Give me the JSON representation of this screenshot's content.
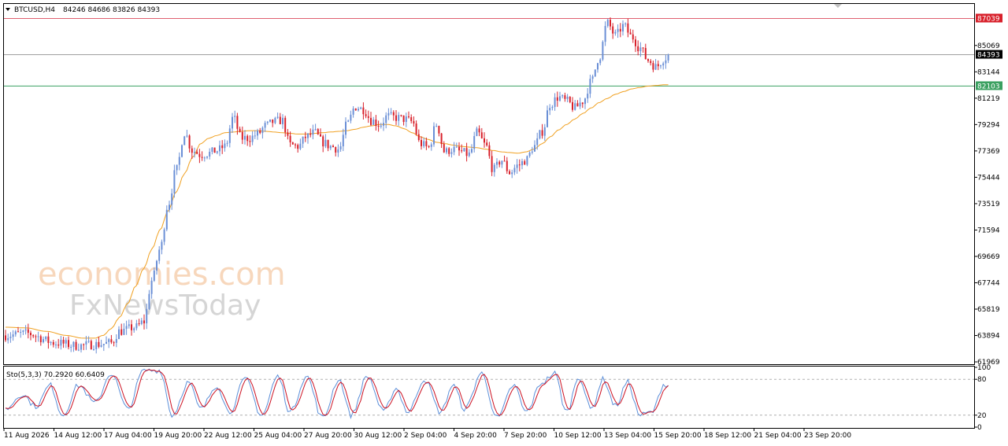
{
  "header": {
    "symbol": "BTCUSD,H4",
    "ohlc": "84246 84686 83826 84393",
    "arrow_icon": "triangle-down-icon"
  },
  "watermark": {
    "line1": "economies.com",
    "line2": "FxNewsToday"
  },
  "colors": {
    "bull": "#6a8fd6",
    "bear": "#d8202a",
    "ma": "#f0a020",
    "stoch_main": "#5b8fd9",
    "stoch_signal": "#cc1122",
    "resistance": "#e06070",
    "support": "#3aa060",
    "price_line": "#a0a0a0"
  },
  "chart_data": {
    "type": "candlestick",
    "price_axis": {
      "ylim": [
        61800,
        88100
      ],
      "ticks": [
        61969,
        63894,
        65819,
        67744,
        69669,
        71594,
        73519,
        75444,
        77369,
        79294,
        81219,
        83144,
        85069
      ]
    },
    "levels": [
      {
        "id": "resistance",
        "value": 87039,
        "label": "87039"
      },
      {
        "id": "current",
        "value": 84393,
        "label": "84393"
      },
      {
        "id": "support",
        "value": 82103,
        "label": "82103"
      }
    ],
    "time_labels": [
      "11 Aug 2026",
      "14 Aug 12:00",
      "17 Aug 04:00",
      "19 Aug 20:00",
      "22 Aug 12:00",
      "25 Aug 04:00",
      "27 Aug 20:00",
      "30 Aug 12:00",
      "2 Sep 04:00",
      "4 Sep 20:00",
      "7 Sep 20:00",
      "10 Sep 12:00",
      "13 Sep 04:00",
      "15 Sep 20:00",
      "18 Sep 12:00",
      "21 Sep 04:00",
      "23 Sep 20:00"
    ],
    "candle_count": 264,
    "close_path": [
      [
        0,
        63900
      ],
      [
        10,
        64050
      ],
      [
        25,
        63350
      ],
      [
        35,
        63150
      ],
      [
        45,
        63250
      ],
      [
        52,
        63350
      ],
      [
        56,
        64200
      ],
      [
        64,
        64500
      ],
      [
        68,
        64900
      ],
      [
        72,
        67900
      ],
      [
        76,
        70200
      ],
      [
        80,
        73500
      ],
      [
        84,
        76000
      ],
      [
        88,
        78700
      ],
      [
        92,
        77400
      ],
      [
        96,
        77100
      ],
      [
        100,
        77200
      ],
      [
        104,
        77400
      ],
      [
        108,
        77700
      ],
      [
        112,
        79800
      ],
      [
        116,
        78300
      ],
      [
        120,
        78300
      ],
      [
        124,
        78600
      ],
      [
        128,
        79200
      ],
      [
        132,
        79500
      ],
      [
        136,
        79600
      ],
      [
        140,
        77800
      ],
      [
        144,
        77700
      ],
      [
        148,
        78400
      ],
      [
        152,
        78700
      ],
      [
        156,
        78000
      ],
      [
        160,
        77700
      ],
      [
        164,
        77500
      ],
      [
        168,
        79300
      ],
      [
        172,
        80600
      ],
      [
        176,
        80400
      ],
      [
        180,
        79600
      ],
      [
        184,
        79300
      ],
      [
        188,
        79900
      ],
      [
        192,
        79800
      ],
      [
        196,
        79700
      ],
      [
        200,
        79500
      ],
      [
        204,
        77900
      ],
      [
        208,
        77600
      ],
      [
        212,
        79300
      ],
      [
        216,
        77300
      ],
      [
        220,
        77500
      ],
      [
        224,
        77300
      ],
      [
        228,
        77100
      ],
      [
        232,
        78700
      ],
      [
        236,
        77800
      ],
      [
        240,
        76000
      ],
      [
        244,
        76700
      ],
      [
        248,
        75800
      ],
      [
        252,
        76300
      ],
      [
        256,
        76700
      ],
      [
        260,
        77700
      ],
      [
        264,
        78800
      ],
      [
        268,
        80800
      ],
      [
        272,
        81300
      ],
      [
        276,
        81000
      ],
      [
        280,
        80500
      ],
      [
        284,
        81000
      ],
      [
        288,
        82400
      ],
      [
        292,
        84200
      ],
      [
        296,
        86700
      ],
      [
        300,
        85800
      ],
      [
        304,
        86500
      ],
      [
        308,
        85700
      ],
      [
        312,
        84900
      ],
      [
        316,
        84000
      ],
      [
        320,
        83500
      ],
      [
        324,
        84100
      ],
      [
        326,
        84393
      ]
    ],
    "ma_path": [
      [
        0,
        64500
      ],
      [
        10,
        64450
      ],
      [
        20,
        64200
      ],
      [
        30,
        63900
      ],
      [
        38,
        63700
      ],
      [
        44,
        63700
      ],
      [
        48,
        63900
      ],
      [
        52,
        64400
      ],
      [
        56,
        65200
      ],
      [
        60,
        66200
      ],
      [
        64,
        67500
      ],
      [
        68,
        68800
      ],
      [
        72,
        70200
      ],
      [
        76,
        71600
      ],
      [
        80,
        73000
      ],
      [
        84,
        74400
      ],
      [
        88,
        75700
      ],
      [
        92,
        76900
      ],
      [
        96,
        77900
      ],
      [
        100,
        78300
      ],
      [
        104,
        78500
      ],
      [
        108,
        78700
      ],
      [
        112,
        78750
      ],
      [
        116,
        78800
      ],
      [
        120,
        78850
      ],
      [
        124,
        78850
      ],
      [
        128,
        78800
      ],
      [
        132,
        78750
      ],
      [
        136,
        78700
      ],
      [
        140,
        78650
      ],
      [
        144,
        78600
      ],
      [
        148,
        78600
      ],
      [
        152,
        78650
      ],
      [
        156,
        78700
      ],
      [
        160,
        78750
      ],
      [
        164,
        78800
      ],
      [
        168,
        78850
      ],
      [
        172,
        78950
      ],
      [
        176,
        79100
      ],
      [
        180,
        79200
      ],
      [
        184,
        79300
      ],
      [
        188,
        79300
      ],
      [
        192,
        79200
      ],
      [
        196,
        79000
      ],
      [
        200,
        78700
      ],
      [
        204,
        78400
      ],
      [
        208,
        78200
      ],
      [
        212,
        78000
      ],
      [
        216,
        77900
      ],
      [
        220,
        77800
      ],
      [
        224,
        77700
      ],
      [
        228,
        77650
      ],
      [
        232,
        77600
      ],
      [
        236,
        77500
      ],
      [
        240,
        77400
      ],
      [
        244,
        77300
      ],
      [
        248,
        77250
      ],
      [
        252,
        77200
      ],
      [
        256,
        77300
      ],
      [
        260,
        77500
      ],
      [
        264,
        77900
      ],
      [
        268,
        78400
      ],
      [
        272,
        78900
      ],
      [
        276,
        79300
      ],
      [
        280,
        79700
      ],
      [
        284,
        80100
      ],
      [
        288,
        80500
      ],
      [
        292,
        80900
      ],
      [
        296,
        81200
      ],
      [
        300,
        81500
      ],
      [
        304,
        81700
      ],
      [
        308,
        81900
      ],
      [
        312,
        82000
      ],
      [
        316,
        82100
      ],
      [
        320,
        82150
      ],
      [
        324,
        82200
      ],
      [
        326,
        82200
      ]
    ],
    "stochastic": {
      "label": "Sto(5,3,3) 70.2920 60.6409",
      "ylim": [
        0,
        100
      ],
      "ticks": [
        0,
        20,
        80,
        100
      ],
      "levels": [
        20,
        80
      ],
      "cycles": [
        [
          0,
          30
        ],
        [
          8,
          55
        ],
        [
          15,
          35
        ],
        [
          22,
          70
        ],
        [
          28,
          20
        ],
        [
          36,
          70
        ],
        [
          44,
          40
        ],
        [
          52,
          90
        ],
        [
          60,
          30
        ],
        [
          68,
          95
        ],
        [
          76,
          95
        ],
        [
          82,
          20
        ],
        [
          90,
          75
        ],
        [
          96,
          30
        ],
        [
          104,
          70
        ],
        [
          110,
          25
        ],
        [
          118,
          80
        ],
        [
          126,
          20
        ],
        [
          134,
          85
        ],
        [
          140,
          25
        ],
        [
          148,
          85
        ],
        [
          156,
          15
        ],
        [
          164,
          80
        ],
        [
          170,
          20
        ],
        [
          178,
          85
        ],
        [
          186,
          25
        ],
        [
          192,
          65
        ],
        [
          198,
          25
        ],
        [
          206,
          80
        ],
        [
          214,
          25
        ],
        [
          220,
          70
        ],
        [
          226,
          30
        ],
        [
          234,
          90
        ],
        [
          242,
          15
        ],
        [
          250,
          70
        ],
        [
          256,
          25
        ],
        [
          264,
          75
        ],
        [
          270,
          90
        ],
        [
          276,
          25
        ],
        [
          282,
          85
        ],
        [
          288,
          30
        ],
        [
          294,
          80
        ],
        [
          300,
          35
        ],
        [
          306,
          75
        ],
        [
          312,
          20
        ],
        [
          318,
          25
        ],
        [
          324,
          72
        ],
        [
          326,
          70
        ]
      ]
    }
  }
}
